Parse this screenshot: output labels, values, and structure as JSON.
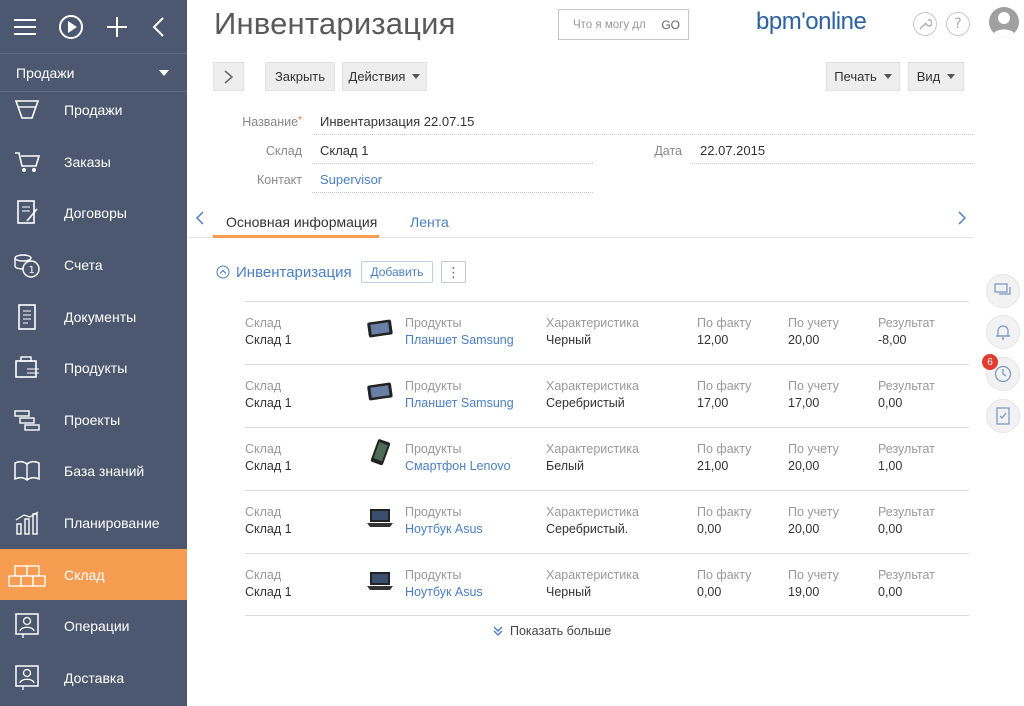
{
  "sidebar": {
    "workspace": "Продажи",
    "items": [
      {
        "label": "Продажи"
      },
      {
        "label": "Заказы"
      },
      {
        "label": "Договоры"
      },
      {
        "label": "Счета"
      },
      {
        "label": "Документы"
      },
      {
        "label": "Продукты"
      },
      {
        "label": "Проекты"
      },
      {
        "label": "База знаний"
      },
      {
        "label": "Планирование"
      },
      {
        "label": "Склад"
      },
      {
        "label": "Операции"
      },
      {
        "label": "Доставка"
      }
    ]
  },
  "header": {
    "title": "Инвентаризация",
    "search_placeholder": "Что я могу дл",
    "search_go": "GO",
    "logo": "bpm'online"
  },
  "toolbar": {
    "close_label": "Закрыть",
    "actions_label": "Действия",
    "print_label": "Печать",
    "view_label": "Вид"
  },
  "form": {
    "name_label": "Название",
    "name_value": "Инвентаризация 22.07.15",
    "warehouse_label": "Склад",
    "warehouse_value": "Склад 1",
    "contact_label": "Контакт",
    "contact_value": "Supervisor",
    "date_label": "Дата",
    "date_value": "22.07.2015"
  },
  "tabs": {
    "main": "Основная информация",
    "feed": "Лента"
  },
  "detail": {
    "title": "Инвентаризация",
    "add_label": "Добавить",
    "more_label": "⋮",
    "captions": {
      "warehouse": "Склад",
      "product": "Продукты",
      "feature": "Характеристика",
      "actual": "По факту",
      "accounting": "По учету",
      "result": "Результат"
    },
    "rows": [
      {
        "warehouse": "Склад 1",
        "product": "Планшет Samsung",
        "feature": "Черный",
        "actual": "12,00",
        "accounting": "20,00",
        "result": "-8,00",
        "thumb": "tablet"
      },
      {
        "warehouse": "Склад 1",
        "product": "Планшет Samsung",
        "feature": "Серебристый",
        "actual": "17,00",
        "accounting": "17,00",
        "result": "0,00",
        "thumb": "tablet"
      },
      {
        "warehouse": "Склад 1",
        "product": "Смартфон Lenovo",
        "feature": "Белый",
        "actual": "21,00",
        "accounting": "20,00",
        "result": "1,00",
        "thumb": "phone"
      },
      {
        "warehouse": "Склад 1",
        "product": "Ноутбук Asus",
        "feature": "Серебристый.",
        "actual": "0,00",
        "accounting": "20,00",
        "result": "0,00",
        "thumb": "laptop"
      },
      {
        "warehouse": "Склад 1",
        "product": "Ноутбук Asus",
        "feature": "Черный",
        "actual": "0,00",
        "accounting": "19,00",
        "result": "0,00",
        "thumb": "laptop"
      }
    ],
    "show_more": "Показать больше"
  },
  "right_panel": {
    "notification_count": "6"
  },
  "colors": {
    "sidebar_bg": "#4c586f",
    "active_accent": "#f79d51",
    "link": "#4a7fc1",
    "badge": "#e03b2e"
  }
}
